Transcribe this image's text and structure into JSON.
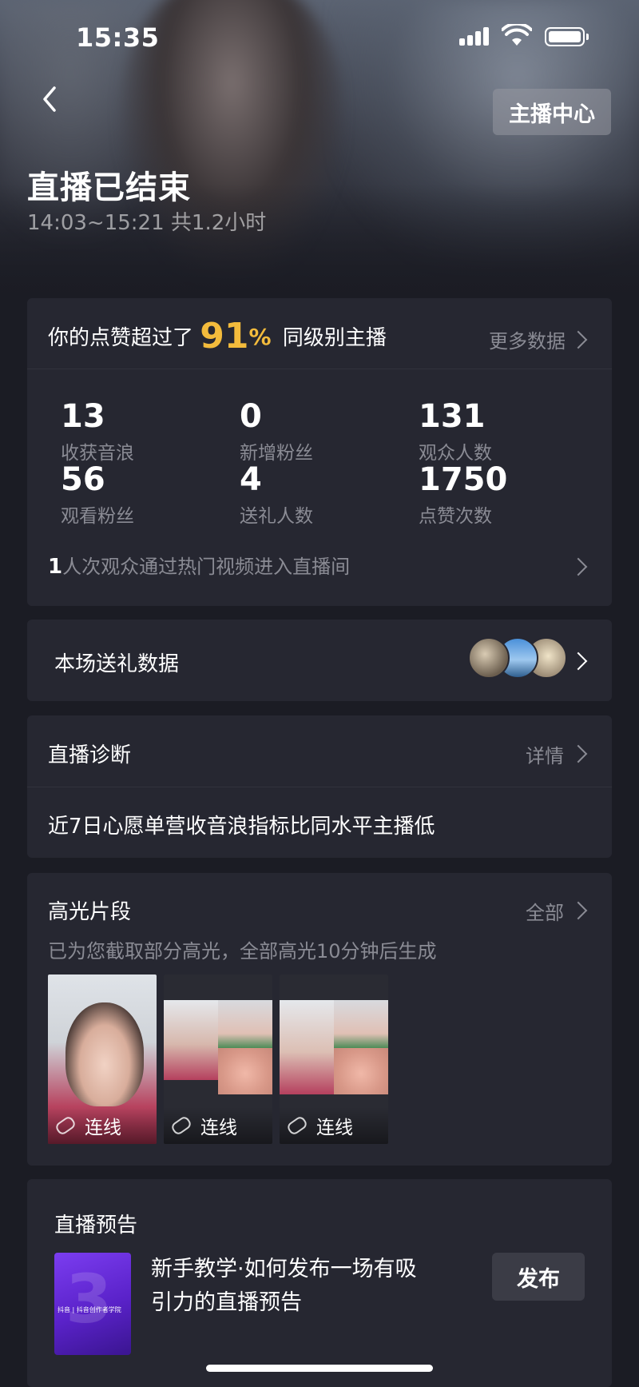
{
  "status_bar": {
    "time": "15:35"
  },
  "header": {
    "anchor_center_label": "主播中心",
    "title": "直播已结束",
    "subtitle": "14:03~15:21 共1.2小时"
  },
  "summary": {
    "prefix": "你的点赞超过了",
    "percent": "91",
    "percent_symbol": "%",
    "suffix": "同级别主播",
    "more_label": "更多数据",
    "stats": [
      {
        "value": "13",
        "label": "收获音浪"
      },
      {
        "value": "0",
        "label": "新增粉丝"
      },
      {
        "value": "131",
        "label": "观众人数"
      },
      {
        "value": "56",
        "label": "观看粉丝"
      },
      {
        "value": "4",
        "label": "送礼人数"
      },
      {
        "value": "1750",
        "label": "点赞次数"
      }
    ],
    "hot_count": "1",
    "hot_text": "人次观众通过热门视频进入直播间"
  },
  "gift": {
    "label": "本场送礼数据"
  },
  "diagnosis": {
    "title": "直播诊断",
    "detail_label": "详情",
    "message": "近7日心愿单营收音浪指标比同水平主播低"
  },
  "highlights": {
    "title": "高光片段",
    "all_label": "全部",
    "desc": "已为您截取部分高光，全部高光10分钟后生成",
    "clips": [
      {
        "caption": "连线"
      },
      {
        "caption": "连线"
      },
      {
        "caption": "连线"
      }
    ]
  },
  "preview": {
    "title": "直播预告",
    "text_line1": "新手教学·如何发布一场有吸",
    "text_line2": "引力的直播预告",
    "publish_label": "发布",
    "cover_text": "抖音 | 抖音创作者学院"
  },
  "colors": {
    "background": "#1b1c24",
    "card": "#262731",
    "accent": "#f3bb3c",
    "muted": "#8a8b94"
  }
}
